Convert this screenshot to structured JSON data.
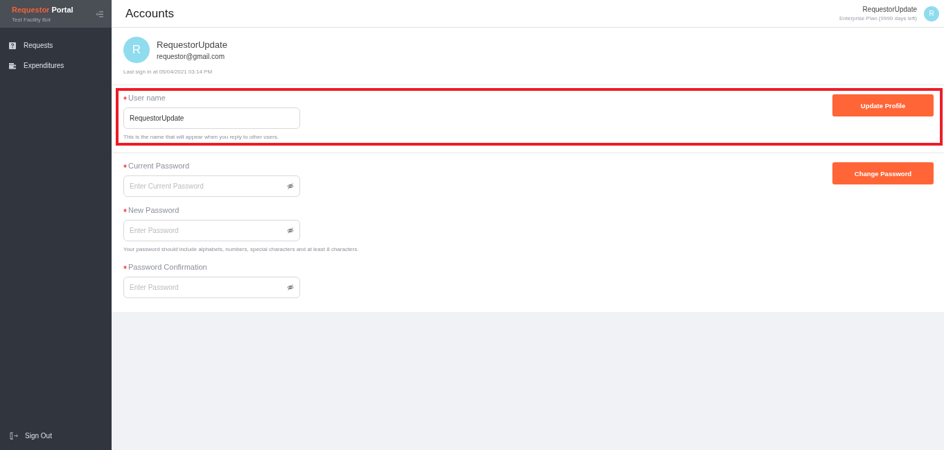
{
  "sidebar": {
    "brand": {
      "name": "Requestor",
      "suffix": "Portal",
      "subtitle": "Test Facility Bot"
    },
    "items": [
      {
        "kind": "question",
        "label": "Requests",
        "selected": false
      },
      {
        "kind": "wallet",
        "label": "Expenditures",
        "selected": false
      }
    ],
    "footer_item": {
      "label": "Sign Out"
    }
  },
  "header": {
    "title": "Accounts",
    "user": {
      "name": "RequestorUpdate",
      "plan": "Enterprise Plan (9999 days left)",
      "avatar_initial": "R"
    }
  },
  "profile": {
    "avatar_initial": "R",
    "name": "RequestorUpdate",
    "email": "requestor@gmail.com",
    "last_sign_in": "Last sign in at 05/04/2021 03:14 PM"
  },
  "sections": [
    {
      "highlighted": true,
      "button": "Update Profile",
      "fields": [
        {
          "kind": "text",
          "label": "User name",
          "required": true,
          "value": "RequestorUpdate",
          "hint": "This is the name that will appear when you reply to other users."
        }
      ]
    },
    {
      "highlighted": false,
      "button": "Change Password",
      "fields": [
        {
          "kind": "password",
          "label": "Current Password",
          "required": true,
          "placeholder": "Enter Current Password"
        },
        {
          "kind": "password",
          "label": "New Password",
          "required": true,
          "placeholder": "Enter Password",
          "hint": "Your password should include alphabets, numbers, special characters and at least 8 characters."
        },
        {
          "kind": "password",
          "label": "Password Confirmation",
          "required": true,
          "placeholder": "Enter Password"
        }
      ]
    }
  ]
}
